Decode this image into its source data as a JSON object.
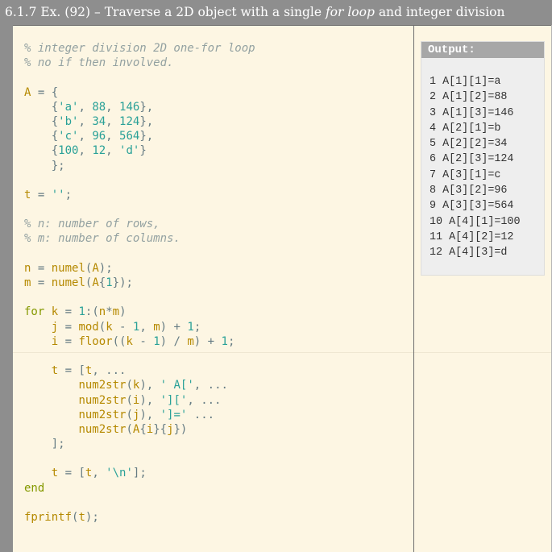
{
  "title": {
    "prefix": "6.1.7 Ex. (92) – Traverse a 2D object with a single ",
    "emphasis": "for loop",
    "suffix": " and integer division"
  },
  "code_lines": [
    [
      {
        "t": "% integer division 2D one-for loop",
        "c": "com"
      }
    ],
    [
      {
        "t": "% no if then involved.",
        "c": "com"
      }
    ],
    [],
    [
      {
        "t": "A",
        "c": "var"
      },
      {
        "t": " = {",
        "c": "punc"
      }
    ],
    [
      {
        "t": "    {",
        "c": "punc"
      },
      {
        "t": "'a'",
        "c": "str"
      },
      {
        "t": ", ",
        "c": "punc"
      },
      {
        "t": "88",
        "c": "num"
      },
      {
        "t": ", ",
        "c": "punc"
      },
      {
        "t": "146",
        "c": "num"
      },
      {
        "t": "},",
        "c": "punc"
      }
    ],
    [
      {
        "t": "    {",
        "c": "punc"
      },
      {
        "t": "'b'",
        "c": "str"
      },
      {
        "t": ", ",
        "c": "punc"
      },
      {
        "t": "34",
        "c": "num"
      },
      {
        "t": ", ",
        "c": "punc"
      },
      {
        "t": "124",
        "c": "num"
      },
      {
        "t": "},",
        "c": "punc"
      }
    ],
    [
      {
        "t": "    {",
        "c": "punc"
      },
      {
        "t": "'c'",
        "c": "str"
      },
      {
        "t": ", ",
        "c": "punc"
      },
      {
        "t": "96",
        "c": "num"
      },
      {
        "t": ", ",
        "c": "punc"
      },
      {
        "t": "564",
        "c": "num"
      },
      {
        "t": "},",
        "c": "punc"
      }
    ],
    [
      {
        "t": "    {",
        "c": "punc"
      },
      {
        "t": "100",
        "c": "num"
      },
      {
        "t": ", ",
        "c": "punc"
      },
      {
        "t": "12",
        "c": "num"
      },
      {
        "t": ", ",
        "c": "punc"
      },
      {
        "t": "'d'",
        "c": "str"
      },
      {
        "t": "}",
        "c": "punc"
      }
    ],
    [
      {
        "t": "    };",
        "c": "punc"
      }
    ],
    [],
    [
      {
        "t": "t",
        "c": "var"
      },
      {
        "t": " = ",
        "c": "punc"
      },
      {
        "t": "''",
        "c": "str"
      },
      {
        "t": ";",
        "c": "punc"
      }
    ],
    [],
    [
      {
        "t": "% n: number of rows,",
        "c": "com"
      }
    ],
    [
      {
        "t": "% m: number of columns.",
        "c": "com"
      }
    ],
    [],
    [
      {
        "t": "n",
        "c": "var"
      },
      {
        "t": " = ",
        "c": "punc"
      },
      {
        "t": "numel",
        "c": "fn"
      },
      {
        "t": "(",
        "c": "punc"
      },
      {
        "t": "A",
        "c": "var"
      },
      {
        "t": ");",
        "c": "punc"
      }
    ],
    [
      {
        "t": "m",
        "c": "var"
      },
      {
        "t": " = ",
        "c": "punc"
      },
      {
        "t": "numel",
        "c": "fn"
      },
      {
        "t": "(",
        "c": "punc"
      },
      {
        "t": "A",
        "c": "var"
      },
      {
        "t": "{",
        "c": "punc"
      },
      {
        "t": "1",
        "c": "num"
      },
      {
        "t": "});",
        "c": "punc"
      }
    ],
    [],
    [
      {
        "t": "for",
        "c": "kw"
      },
      {
        "t": " ",
        "c": "punc"
      },
      {
        "t": "k",
        "c": "var"
      },
      {
        "t": " = ",
        "c": "punc"
      },
      {
        "t": "1",
        "c": "num"
      },
      {
        "t": ":(",
        "c": "punc"
      },
      {
        "t": "n",
        "c": "var"
      },
      {
        "t": "*",
        "c": "punc"
      },
      {
        "t": "m",
        "c": "var"
      },
      {
        "t": ")",
        "c": "punc"
      }
    ],
    [
      {
        "t": "    ",
        "c": "punc"
      },
      {
        "t": "j",
        "c": "var"
      },
      {
        "t": " = ",
        "c": "punc"
      },
      {
        "t": "mod",
        "c": "fn"
      },
      {
        "t": "(",
        "c": "punc"
      },
      {
        "t": "k",
        "c": "var"
      },
      {
        "t": " - ",
        "c": "punc"
      },
      {
        "t": "1",
        "c": "num"
      },
      {
        "t": ", ",
        "c": "punc"
      },
      {
        "t": "m",
        "c": "var"
      },
      {
        "t": ") + ",
        "c": "punc"
      },
      {
        "t": "1",
        "c": "num"
      },
      {
        "t": ";",
        "c": "punc"
      }
    ],
    [
      {
        "t": "    ",
        "c": "punc"
      },
      {
        "t": "i",
        "c": "var"
      },
      {
        "t": " = ",
        "c": "punc"
      },
      {
        "t": "floor",
        "c": "fn"
      },
      {
        "t": "((",
        "c": "punc"
      },
      {
        "t": "k",
        "c": "var"
      },
      {
        "t": " - ",
        "c": "punc"
      },
      {
        "t": "1",
        "c": "num"
      },
      {
        "t": ") / ",
        "c": "punc"
      },
      {
        "t": "m",
        "c": "var"
      },
      {
        "t": ") + ",
        "c": "punc"
      },
      {
        "t": "1",
        "c": "num"
      },
      {
        "t": ";",
        "c": "punc"
      }
    ],
    [],
    [
      {
        "t": "    ",
        "c": "punc"
      },
      {
        "t": "t",
        "c": "var"
      },
      {
        "t": " = [",
        "c": "punc"
      },
      {
        "t": "t",
        "c": "var"
      },
      {
        "t": ", ...",
        "c": "punc"
      }
    ],
    [
      {
        "t": "        ",
        "c": "punc"
      },
      {
        "t": "num2str",
        "c": "fn"
      },
      {
        "t": "(",
        "c": "punc"
      },
      {
        "t": "k",
        "c": "var"
      },
      {
        "t": "), ",
        "c": "punc"
      },
      {
        "t": "' A['",
        "c": "str"
      },
      {
        "t": ", ...",
        "c": "punc"
      }
    ],
    [
      {
        "t": "        ",
        "c": "punc"
      },
      {
        "t": "num2str",
        "c": "fn"
      },
      {
        "t": "(",
        "c": "punc"
      },
      {
        "t": "i",
        "c": "var"
      },
      {
        "t": "), ",
        "c": "punc"
      },
      {
        "t": "']['",
        "c": "str"
      },
      {
        "t": ", ...",
        "c": "punc"
      }
    ],
    [
      {
        "t": "        ",
        "c": "punc"
      },
      {
        "t": "num2str",
        "c": "fn"
      },
      {
        "t": "(",
        "c": "punc"
      },
      {
        "t": "j",
        "c": "var"
      },
      {
        "t": "), ",
        "c": "punc"
      },
      {
        "t": "']='",
        "c": "str"
      },
      {
        "t": " ...",
        "c": "punc"
      }
    ],
    [
      {
        "t": "        ",
        "c": "punc"
      },
      {
        "t": "num2str",
        "c": "fn"
      },
      {
        "t": "(",
        "c": "punc"
      },
      {
        "t": "A",
        "c": "var"
      },
      {
        "t": "{",
        "c": "punc"
      },
      {
        "t": "i",
        "c": "var"
      },
      {
        "t": "}{",
        "c": "punc"
      },
      {
        "t": "j",
        "c": "var"
      },
      {
        "t": "})",
        "c": "punc"
      }
    ],
    [
      {
        "t": "    ];",
        "c": "punc"
      }
    ],
    [],
    [
      {
        "t": "    ",
        "c": "punc"
      },
      {
        "t": "t",
        "c": "var"
      },
      {
        "t": " = [",
        "c": "punc"
      },
      {
        "t": "t",
        "c": "var"
      },
      {
        "t": ", ",
        "c": "punc"
      },
      {
        "t": "'\\n'",
        "c": "str"
      },
      {
        "t": "];",
        "c": "punc"
      }
    ],
    [
      {
        "t": "end",
        "c": "kw"
      }
    ],
    [],
    [
      {
        "t": "fprintf",
        "c": "fn"
      },
      {
        "t": "(",
        "c": "punc"
      },
      {
        "t": "t",
        "c": "var"
      },
      {
        "t": ");",
        "c": "punc"
      }
    ]
  ],
  "output": {
    "header": "Output:",
    "lines": [
      "1 A[1][1]=a",
      "2 A[1][2]=88",
      "3 A[1][3]=146",
      "4 A[2][1]=b",
      "5 A[2][2]=34",
      "6 A[2][3]=124",
      "7 A[3][1]=c",
      "8 A[3][2]=96",
      "9 A[3][3]=564",
      "10 A[4][1]=100",
      "11 A[4][2]=12",
      "12 A[4][3]=d"
    ]
  },
  "colors": {
    "background": "#fdf6e3",
    "chrome": "#8e8e8e",
    "comment": "#93a1a1",
    "variable": "#b58900",
    "keyword": "#859900",
    "literal": "#2aa198",
    "punctuation": "#657b83"
  }
}
